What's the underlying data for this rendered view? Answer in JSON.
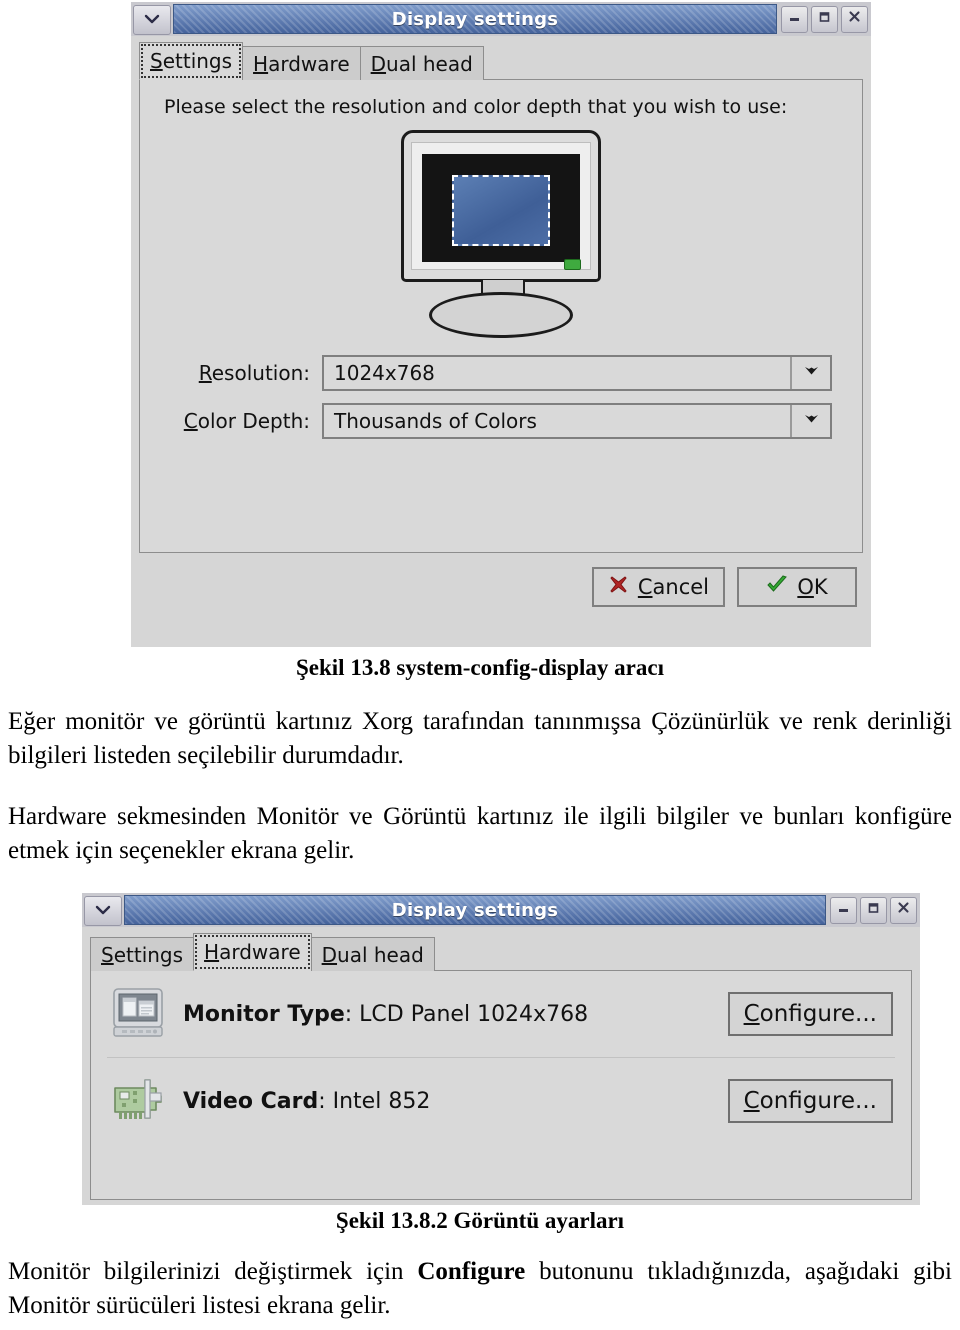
{
  "document": {
    "figure1_caption": "Şekil 13.8 system-config-display aracı",
    "paragraph1": "Eğer monitör ve görüntü kartınız Xorg tarafından tanınmışsa Çözünürlük ve renk derinliği bilgileri listeden seçilebilir durumdadır.",
    "paragraph2": "Hardware sekmesinden Monitör ve Görüntü kartınız ile ilgili bilgiler ve bunları konfigüre etmek için seçenekler ekrana gelir.",
    "figure2_caption": "Şekil 13.8.2 Görüntü ayarları",
    "paragraph3_part1": "Monitör bilgilerinizi değiştirmek için ",
    "paragraph3_bold": "Configure",
    "paragraph3_part2": " butonunu tıkladığınızda, aşağıdaki gibi Monitör sürücüleri listesi ekrana gelir."
  },
  "window1": {
    "title": "Display settings",
    "menu_icon": "chevron-down-icon",
    "buttons": {
      "minimize": "minimize-icon",
      "maximize": "maximize-icon",
      "close": "close-icon"
    },
    "tabs": [
      {
        "label": "Settings",
        "mnemonic": "S",
        "rest": "ettings",
        "selected": true
      },
      {
        "label": "Hardware",
        "mnemonic": "H",
        "rest": "ardware",
        "selected": false
      },
      {
        "label": "Dual head",
        "mnemonic": "D",
        "rest": "ual head",
        "selected": false
      }
    ],
    "settings": {
      "hint": "Please select the resolution and color depth that you wish to use:",
      "preview_icon": "crt-monitor-preview",
      "fields": [
        {
          "label_mnemonic": "R",
          "label_rest": "esolution:",
          "value": "1024x768"
        },
        {
          "label_mnemonic": "C",
          "label_rest": "olor Depth:",
          "value": "Thousands of Colors"
        }
      ]
    },
    "actions": [
      {
        "mnemonic": "C",
        "rest": "ancel",
        "icon": "red-x-icon"
      },
      {
        "mnemonic": "O",
        "rest": "K",
        "icon": "green-check-icon"
      }
    ]
  },
  "window2": {
    "title": "Display settings",
    "menu_icon": "chevron-down-icon",
    "buttons": {
      "minimize": "minimize-icon",
      "maximize": "maximize-icon",
      "close": "close-icon"
    },
    "tabs": [
      {
        "label": "Settings",
        "mnemonic": "S",
        "rest": "ettings",
        "selected": false
      },
      {
        "label": "Hardware",
        "mnemonic": "H",
        "rest": "ardware",
        "selected": true
      },
      {
        "label": "Dual head",
        "mnemonic": "D",
        "rest": "ual head",
        "selected": false
      }
    ],
    "hardware": {
      "rows": [
        {
          "icon": "monitor-icon",
          "label": "Monitor Type",
          "separator": ": ",
          "value": "LCD Panel 1024x768",
          "button_mnemonic": "C",
          "button_rest": "onfigure..."
        },
        {
          "icon": "video-card-icon",
          "label": "Video Card",
          "separator": ": ",
          "value": "Intel 852",
          "button_mnemonic": "C",
          "button_rest": "onfigure..."
        }
      ]
    }
  },
  "colors": {
    "titlebar_blue": "#45639c",
    "window_grey": "#d6d6d6",
    "panel_grey": "#d9d9d9",
    "cancel_red": "#b02525",
    "ok_green": "#33aa33",
    "desktop_blue": "#4d6ea6",
    "led_green": "#3faa3f"
  }
}
